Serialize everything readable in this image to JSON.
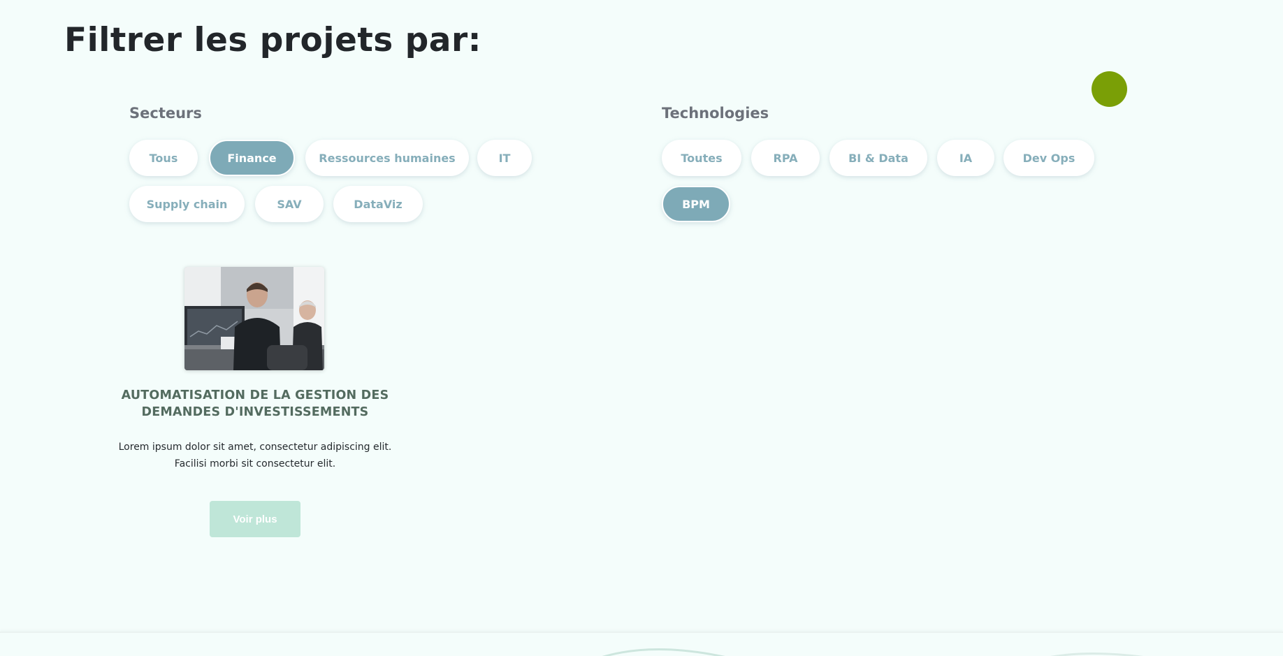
{
  "page": {
    "title": "Filtrer les projets par:"
  },
  "filters": {
    "sectors": {
      "label": "Secteurs",
      "items": [
        {
          "label": "Tous",
          "active": false
        },
        {
          "label": "Finance",
          "active": true
        },
        {
          "label": "Ressources humaines",
          "active": false
        },
        {
          "label": "IT",
          "active": false
        },
        {
          "label": "Supply chain",
          "active": false
        },
        {
          "label": "SAV",
          "active": false
        },
        {
          "label": "DataViz",
          "active": false
        }
      ]
    },
    "technologies": {
      "label": "Technologies",
      "items": [
        {
          "label": "Toutes",
          "active": false
        },
        {
          "label": "RPA",
          "active": false
        },
        {
          "label": "BI & Data",
          "active": false
        },
        {
          "label": "IA",
          "active": false
        },
        {
          "label": "Dev Ops",
          "active": false
        },
        {
          "label": "BPM",
          "active": true
        }
      ]
    }
  },
  "project": {
    "title_line1": "AUTOMATISATION DE LA GESTION DES",
    "title_line2": "DEMANDES D'INVESTISSEMENTS",
    "text_line1": "Lorem ipsum dolor sit amet, consectetur adipiscing elit.",
    "text_line2": "Facilisi morbi sit consectetur elit.",
    "button_label": "Voir plus"
  },
  "colors": {
    "background": "#f4fdfb",
    "chip_text": "#86aeba",
    "chip_active": "#7eaab7",
    "accent_blob": "#7a9f06",
    "project_title": "#536b5f",
    "button": "#bfe6d8"
  }
}
